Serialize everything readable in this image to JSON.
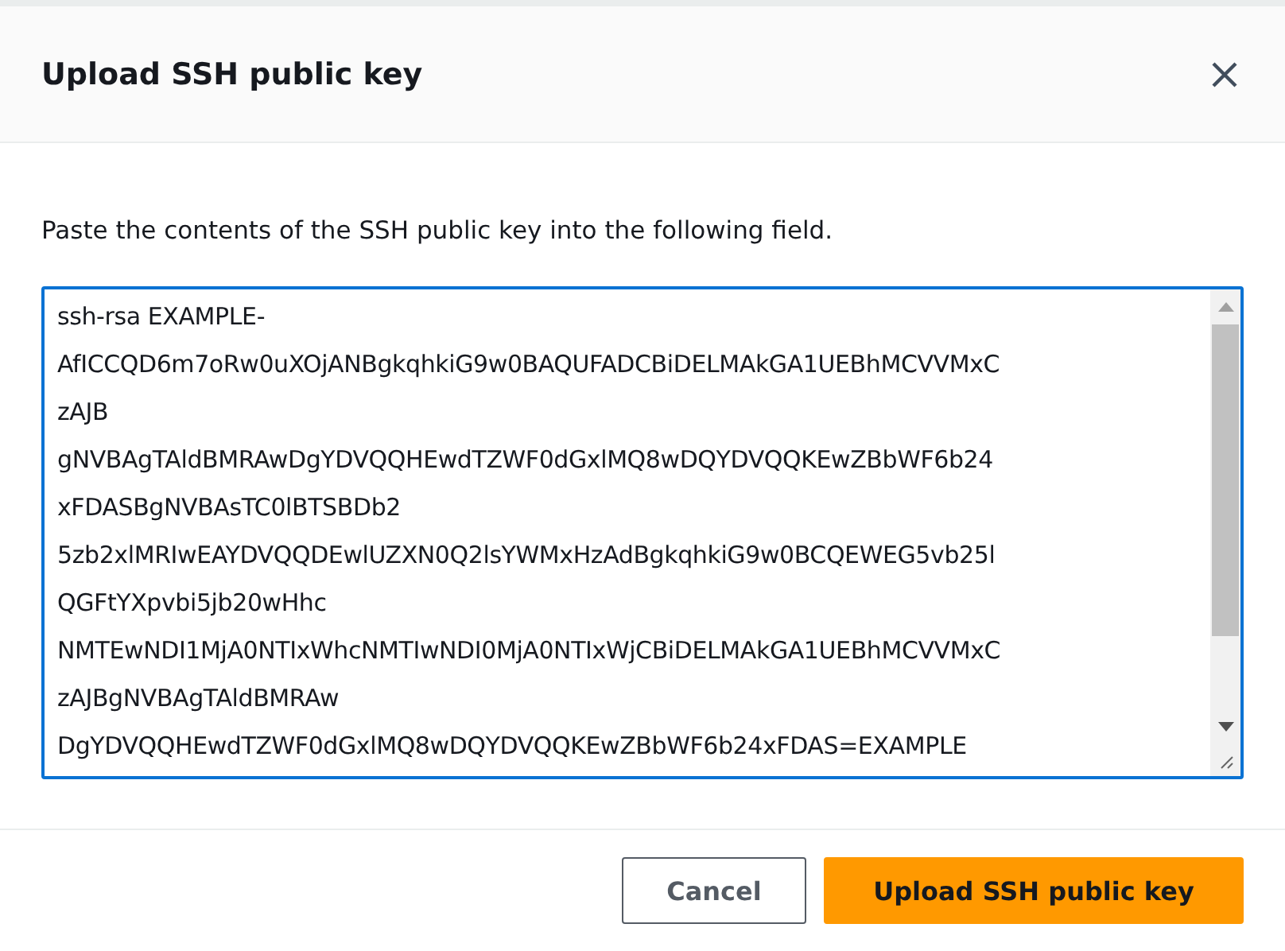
{
  "dialog": {
    "title": "Upload SSH public key",
    "description": "Paste the contents of the SSH public key into the following field.",
    "key_field": {
      "value": "ssh-rsa EXAMPLE-\nAfICCQD6m7oRw0uXOjANBgkqhkiG9w0BAQUFADCBiDELMAkGA1UEBhMCVVMxC\nzAJB\ngNVBAgTAldBMRAwDgYDVQQHEwdTZWF0dGxlMQ8wDQYDVQQKEwZBbWF6b24\nxFDASBgNVBAsTC0lBTSBDb2\n5zb2xlMRIwEAYDVQQDEwlUZXN0Q2lsYWMxHzAdBgkqhkiG9w0BCQEWEG5vb25l\nQGFtYXpvbi5jb20wHhc\nNMTEwNDI1MjA0NTIxWhcNMTIwNDI0MjA0NTIxWjCBiDELMAkGA1UEBhMCVVMxC\nzAJBgNVBAgTAldBMRAw\nDgYDVQQHEwdTZWF0dGxlMQ8wDQYDVQQKEwZBbWF6b24xFDAS=EXAMPLE"
    },
    "buttons": [
      {
        "label": "Cancel",
        "kind": "secondary"
      },
      {
        "label": "Upload SSH public key",
        "kind": "primary"
      }
    ]
  }
}
